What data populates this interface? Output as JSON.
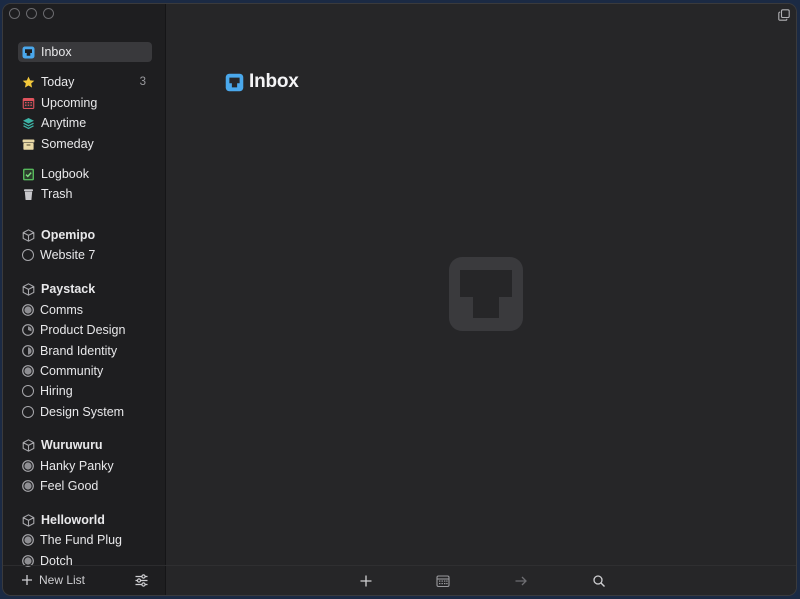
{
  "sidebar": {
    "inbox": {
      "label": "Inbox",
      "icon": "inbox-tray-icon"
    },
    "today": {
      "label": "Today",
      "count": "3",
      "icon": "star-icon"
    },
    "upcoming": {
      "label": "Upcoming",
      "icon": "calendar-icon"
    },
    "anytime": {
      "label": "Anytime",
      "icon": "layers-icon"
    },
    "someday": {
      "label": "Someday",
      "icon": "archive-box-icon"
    },
    "logbook": {
      "label": "Logbook",
      "icon": "logbook-check-icon"
    },
    "trash": {
      "label": "Trash",
      "icon": "trash-icon"
    },
    "areas": [
      {
        "name": "Opemipo",
        "projects": [
          {
            "name": "Website 7",
            "progress": 0
          }
        ]
      },
      {
        "name": "Paystack",
        "projects": [
          {
            "name": "Comms",
            "progress": 1
          },
          {
            "name": "Product Design",
            "progress": 0.35
          },
          {
            "name": "Brand Identity",
            "progress": 0.5
          },
          {
            "name": "Community",
            "progress": 1
          },
          {
            "name": "Hiring",
            "progress": 0
          },
          {
            "name": "Design System",
            "progress": 0
          }
        ]
      },
      {
        "name": "Wuruwuru",
        "projects": [
          {
            "name": "Hanky Panky",
            "progress": 1
          },
          {
            "name": "Feel Good",
            "progress": 1
          }
        ]
      },
      {
        "name": "Helloworld",
        "projects": [
          {
            "name": "The Fund Plug",
            "progress": 1
          },
          {
            "name": "Dotch",
            "progress": 1
          }
        ]
      }
    ],
    "footer": {
      "new_list": "New List"
    }
  },
  "main": {
    "title": "Inbox"
  },
  "colors": {
    "inbox_blue": "#4aa8ec",
    "star_yellow": "#f3c83b",
    "upcoming_red": "#e0535d",
    "anytime_teal": "#3db4a6",
    "someday_beige": "#e9d9a6",
    "logbook_green": "#56b75b"
  }
}
